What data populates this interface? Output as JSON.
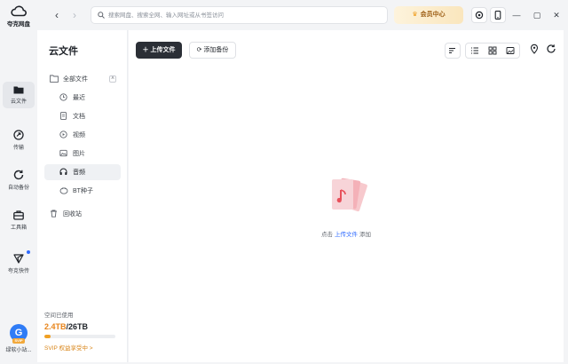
{
  "app": {
    "logo_text": "夸克网盘"
  },
  "rail": {
    "items": [
      {
        "label": "云文件",
        "icon": "folder-icon",
        "active": true
      },
      {
        "label": "传输",
        "icon": "transfer-icon"
      },
      {
        "label": "自动备份",
        "icon": "sync-icon"
      },
      {
        "label": "工具箱",
        "icon": "toolbox-icon"
      },
      {
        "label": "夸克快传",
        "icon": "send-icon",
        "badge": true
      }
    ],
    "user": {
      "name": "绿软小站...",
      "avatar_letter": "G",
      "tag": "SVIP"
    }
  },
  "topbar": {
    "search_placeholder": "搜索网盘、搜索全网、输入网址或从书签访问",
    "vip_label": "会员中心"
  },
  "panel": {
    "title": "云文件",
    "tree": [
      {
        "label": "全部文件",
        "icon": "folder-outline-icon",
        "level": 0
      },
      {
        "label": "最近",
        "icon": "clock-icon",
        "level": 1
      },
      {
        "label": "文档",
        "icon": "document-icon",
        "level": 1
      },
      {
        "label": "视频",
        "icon": "play-icon",
        "level": 1
      },
      {
        "label": "图片",
        "icon": "image-icon",
        "level": 1
      },
      {
        "label": "音频",
        "icon": "headphones-icon",
        "level": 1,
        "active": true
      },
      {
        "label": "BT种子",
        "icon": "bt-icon",
        "level": 1
      },
      {
        "label": "回收站",
        "icon": "trash-icon",
        "level": 0
      }
    ],
    "storage": {
      "label": "空间已使用",
      "used": "2.4TB",
      "separator": "/",
      "total": "26TB",
      "used_fraction": 0.09
    },
    "svip_line": "SVIP 权益享受中 >"
  },
  "main": {
    "upload_label": "上传文件",
    "backup_label": "添加备份",
    "empty": {
      "prefix": "点击",
      "link": "上传文件",
      "suffix": "添加"
    }
  },
  "colors": {
    "accent": "#2f6bff",
    "upload_bg": "#2b2f36",
    "vip_text": "#9b5c12",
    "storage_used": "#e8841a"
  }
}
